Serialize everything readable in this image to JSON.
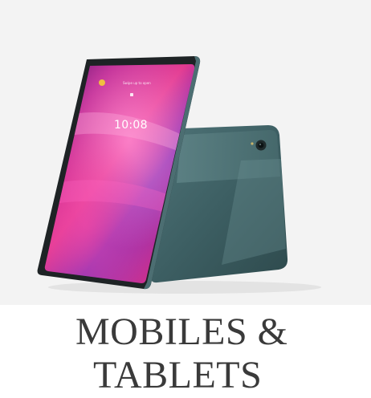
{
  "product": {
    "screen_time": "10:08",
    "screen_header": "Swipe up to open"
  },
  "caption": {
    "line1": "MOBILES &",
    "line2": "TABLETS"
  },
  "colors": {
    "background": "#f3f3f3",
    "tablet_back": "#3e6266",
    "tablet_bezel": "#1e2325",
    "caption_text": "#3a3a3a"
  }
}
